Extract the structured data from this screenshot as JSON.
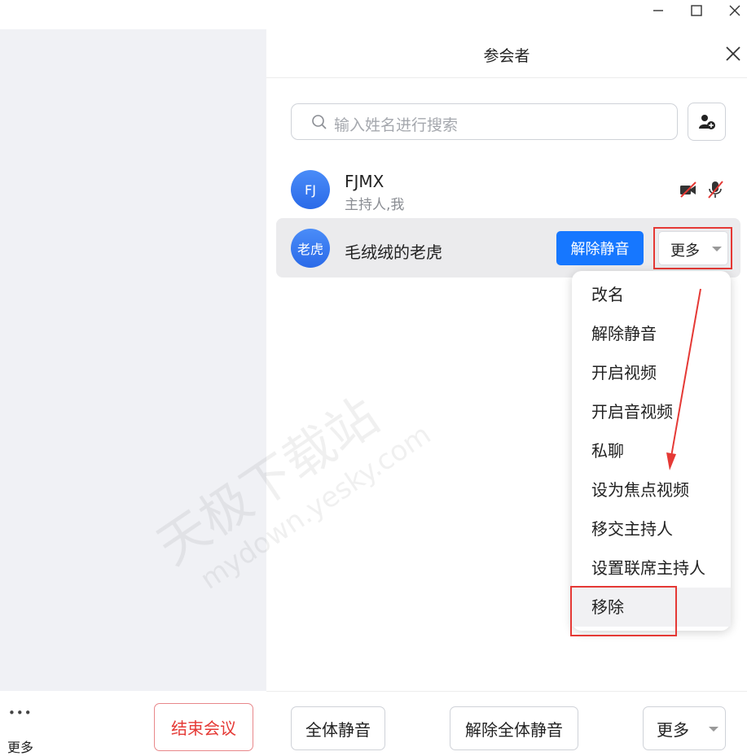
{
  "window": {
    "minimize_icon": "minimize-icon",
    "maximize_icon": "maximize-icon",
    "close_icon": "close-icon"
  },
  "left": {
    "more_dots": "•••",
    "more_label": "更多",
    "end_meeting_label": "结束会议",
    "end_meeting_color": "#e53935"
  },
  "panel": {
    "title": "参会者",
    "search_placeholder": "输入姓名进行搜索",
    "add_participant_icon": "add-user-icon"
  },
  "participants": [
    {
      "avatar": "FJ",
      "name": "FJMX",
      "subtitle": "主持人,我",
      "video_icon": "video-off-icon",
      "mic_icon": "mic-off-icon"
    },
    {
      "avatar": "老虎",
      "name": "毛绒绒的老虎",
      "unmute_label": "解除静音",
      "more_label": "更多"
    }
  ],
  "menu": {
    "items": [
      "改名",
      "解除静音",
      "开启视频",
      "开启音视频",
      "私聊",
      "设为焦点视频",
      "移交主持人",
      "设置联席主持人",
      "移除"
    ]
  },
  "footer": {
    "mute_all": "全体静音",
    "unmute_all": "解除全体静音",
    "more": "更多"
  },
  "watermark": {
    "line1": "天极下载站",
    "line2": "mydown.yesky.com"
  },
  "colors": {
    "accent": "#1677ff",
    "annotation_red": "#e53935",
    "avatar_blue": "#2a6ae8"
  }
}
